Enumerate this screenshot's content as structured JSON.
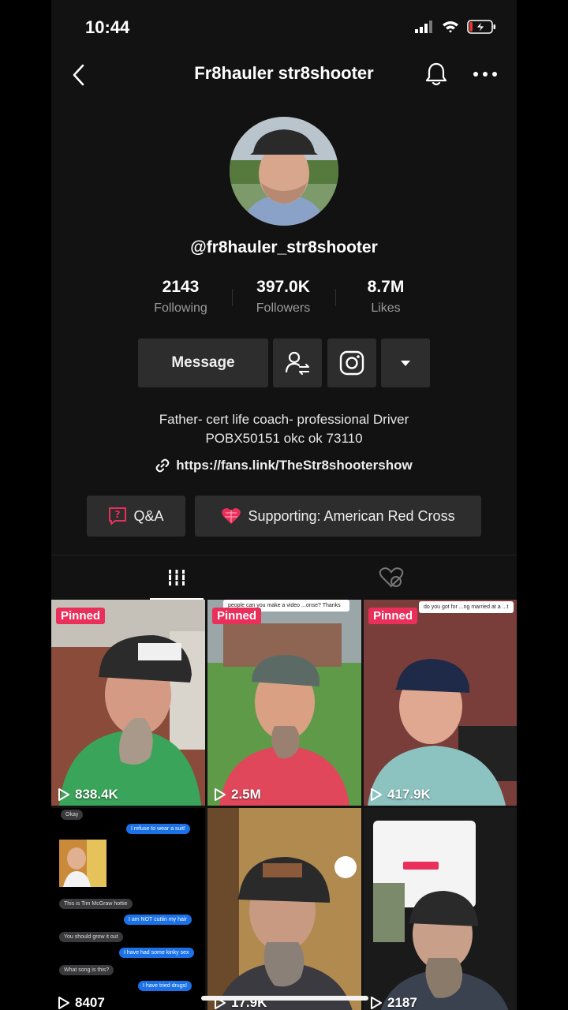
{
  "status_bar": {
    "time": "10:44"
  },
  "header": {
    "title": "Fr8hauler str8shooter"
  },
  "profile": {
    "handle": "@fr8hauler_str8shooter",
    "stats": [
      {
        "value": "2143",
        "label": "Following"
      },
      {
        "value": "397.0K",
        "label": "Followers"
      },
      {
        "value": "8.7M",
        "label": "Likes"
      }
    ],
    "message_label": "Message",
    "bio_line1": "Father- cert life coach- professional Driver",
    "bio_line2": "POBX50151 okc ok 73110",
    "link": "https://fans.link/TheStr8shootershow",
    "qa_label": "Q&A",
    "supporting_label": "Supporting: American Red Cross"
  },
  "videos": [
    {
      "pinned": "Pinned",
      "views": "838.4K"
    },
    {
      "pinned": "Pinned",
      "views": "2.5M",
      "caption": "people can you make a video ...onse? Thanks"
    },
    {
      "pinned": "Pinned",
      "views": "417.9K",
      "caption": "do you got for ...ng married at a ...t"
    },
    {
      "views": "8407"
    },
    {
      "views": "17.9K"
    },
    {
      "views": "2187"
    }
  ],
  "chat": {
    "messages": [
      {
        "side": "in",
        "text": "Okay"
      },
      {
        "side": "out",
        "text": "I refuse to wear a suit!"
      },
      {
        "side": "in",
        "text": "This is Tim McGraw hottie"
      },
      {
        "side": "out",
        "text": "I am NOT cuttin my hair"
      },
      {
        "side": "in",
        "text": "You should grow it out"
      },
      {
        "side": "out",
        "text": "I have had some kinky sex"
      },
      {
        "side": "in",
        "text": "What song is this?"
      },
      {
        "side": "out",
        "text": "I have tried drugs!"
      }
    ]
  },
  "colors": {
    "pinned": "#ea2f5b",
    "background": "#121212",
    "button": "#2d2d2d"
  }
}
